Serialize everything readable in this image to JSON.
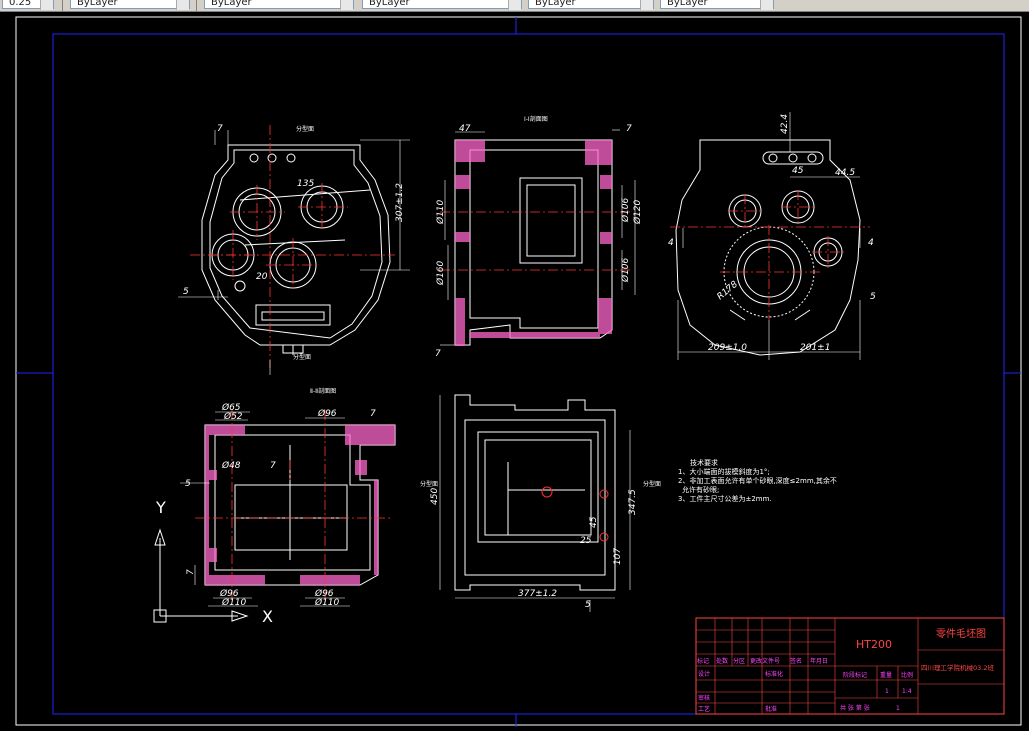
{
  "toolbar": {
    "combos": [
      "0.25",
      "ByLayer",
      "ByLayer",
      "ByLayer",
      "ByLayer",
      "ByLayer"
    ]
  },
  "views": {
    "section_a_title": "Ⅰ-Ⅰ剖面图",
    "section_b_title": "Ⅱ-Ⅱ剖面图",
    "parting_label": "分型面"
  },
  "dims": {
    "d42_4": "42.4",
    "d45": "45",
    "d44_5": "44.5",
    "d4": "4",
    "d5": "5",
    "d209": "209±1.0",
    "d201": "201±1",
    "r178": "R178",
    "d47": "47",
    "d7": "7",
    "d96": "Ø96",
    "d110": "Ø110",
    "d106": "Ø106",
    "d120": "Ø120",
    "d160": "Ø160",
    "d140": "Ø140",
    "d3074": "307±1.2",
    "d20": "20",
    "d135": "135",
    "d65": "Ø65",
    "d52": "Ø52",
    "d48": "Ø48",
    "d450": "450",
    "d3475": "347.5",
    "d107": "107",
    "d377": "377±1.2",
    "d25": "25",
    "d45b": "45",
    "dI": "I"
  },
  "tech_requirements": {
    "title": "技术要求",
    "items": [
      "1、大小端面的拔模斜度为1°;",
      "2、非加工表面允许有单个砂眼,深度≤2mm,其余不",
      "允许有砂眼;",
      "3、工件主尺寸公差为±2mm."
    ]
  },
  "title_block": {
    "material": "HT200",
    "drawing_name": "零件毛坯图",
    "school": "四川理工学院机械03.2班",
    "row_labels": [
      "标记",
      "处数",
      "分区",
      "更改文件号",
      "签名",
      "年月日"
    ],
    "design": "设计",
    "standardize": "标准化",
    "stage_mark": "阶段标记",
    "weight": "重量",
    "scale": "比例",
    "scale_val": "1:4",
    "review": "审核",
    "process": "工艺",
    "approve": "批准",
    "qty_val": "1",
    "sheets": "共  张 第  张",
    "sheets_val": "1"
  },
  "ucs": {
    "y": "Y",
    "x": "X"
  },
  "colors": {
    "frame": "#ffffff",
    "border_blue": "#2222ff",
    "center": "#ff3333",
    "hatch": "#ff66cc",
    "outline": "#ffffff",
    "dim": "#ffffff"
  }
}
